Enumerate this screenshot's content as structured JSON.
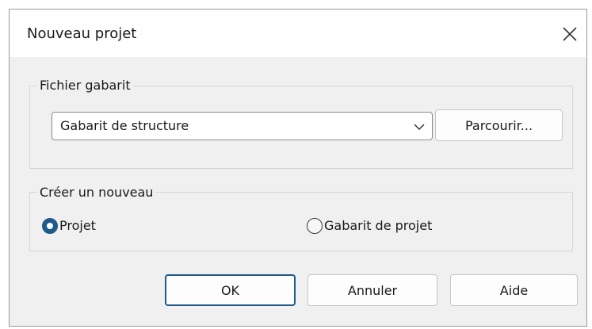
{
  "dialog": {
    "title": "Nouveau projet"
  },
  "template_group": {
    "label": "Fichier gabarit",
    "selected_template": "Gabarit de structure",
    "browse_label": "Parcourir..."
  },
  "create_group": {
    "label": "Créer un nouveau",
    "options": [
      {
        "label": "Projet",
        "checked": true
      },
      {
        "label": "Gabarit de projet",
        "checked": false
      }
    ]
  },
  "buttons": {
    "ok": "OK",
    "cancel": "Annuler",
    "help": "Aide"
  },
  "colors": {
    "accent": "#1f5a8a",
    "dialog_bg": "#f0f0f0"
  }
}
